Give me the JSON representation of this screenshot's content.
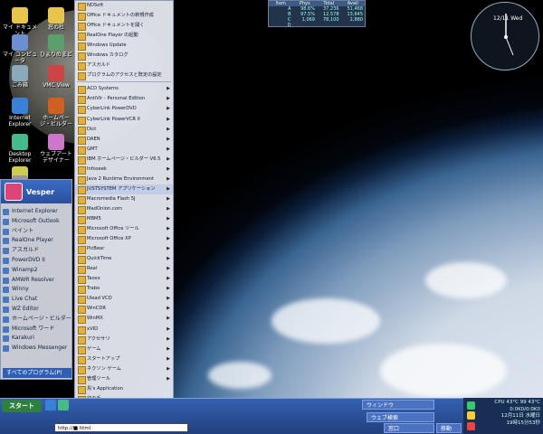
{
  "desktop_icons": [
    {
      "label": "マイ ドキュメント",
      "icon": "folder-icon",
      "color": "#e8c44a"
    },
    {
      "label": "窓の杜",
      "icon": "folder-icon",
      "color": "#e8c44a"
    },
    {
      "label": "マイ コンピュータ",
      "icon": "computer-icon",
      "color": "#6b8fd0"
    },
    {
      "label": "ひよりのまど",
      "icon": "globe-icon",
      "color": "#5aa06b"
    },
    {
      "label": "ごみ箱",
      "icon": "recycle-bin-icon",
      "color": "#8ab"
    },
    {
      "label": "VMC View",
      "icon": "vm-icon",
      "color": "#c44"
    },
    {
      "label": "Internet Explorer",
      "icon": "ie-icon",
      "color": "#3a7fd8"
    },
    {
      "label": "ホームページ・ビルダー",
      "icon": "builder-icon",
      "color": "#d06020"
    },
    {
      "label": "Desktop Explorer",
      "icon": "desktop-icon",
      "color": "#4b8"
    },
    {
      "label": "ウェブアートデザイナー",
      "icon": "design-icon",
      "color": "#c7c"
    },
    {
      "label": "",
      "icon": "text-icon",
      "color": "#cc5"
    },
    {
      "label": "",
      "icon": "tool-icon",
      "color": "#999"
    }
  ],
  "meter": {
    "headers": [
      "Item",
      "Phys",
      "Total",
      "Avail"
    ],
    "rows": [
      [
        "A",
        "98.6%",
        "37,236",
        "51,468"
      ],
      [
        "B",
        "97.5%",
        "12,578",
        "13,645"
      ],
      [
        "C",
        "1,069",
        "78,100",
        "2,880"
      ],
      [
        "D",
        "",
        "",
        ""
      ]
    ]
  },
  "clock": {
    "date": "12/11 Wed"
  },
  "start_menu": {
    "user": "Vesper",
    "pinned": [
      "Internet Explorer",
      "Microsoft Outlook",
      "ペイント",
      "RealOne Player",
      "アスガルド",
      "PowerDVD II",
      "Winamp2",
      "AMWR Resolver",
      "Winny",
      "Live Chat",
      "WZ Editor",
      "ホームページ・ビルダー",
      "Microsoft ワード",
      "Karakuri",
      "Windows Messenger"
    ],
    "all_programs": "すべてのプログラム(P)"
  },
  "program_menu": {
    "top_items": [
      "NDSoft",
      "Office ドキュメントの新規作成",
      "Office ドキュメントを開く",
      "RealOne Player の起動",
      "Windows Update",
      "Windows カタログ",
      "アスガルド",
      "プログラムのアクセスと既定の設定"
    ],
    "items": [
      {
        "label": "ACD Systems",
        "sub": true
      },
      {
        "label": "AntiVir - Personal Edition",
        "sub": true
      },
      {
        "label": "CyberLink PowerDVD",
        "sub": true
      },
      {
        "label": "CyberLink PowerVCR II",
        "sub": true
      },
      {
        "label": "Dict",
        "sub": true
      },
      {
        "label": "DAEN",
        "sub": true
      },
      {
        "label": "GMT",
        "sub": true
      },
      {
        "label": "IBM ホームページ・ビルダー V6.5",
        "sub": true
      },
      {
        "label": "Infoseek",
        "sub": true
      },
      {
        "label": "Java 2 Runtime Environment",
        "sub": true
      },
      {
        "label": "JUSTSYSTEM アプリケーション",
        "sub": true,
        "selected": true
      },
      {
        "label": "Macromedia Flash 5J",
        "sub": true
      },
      {
        "label": "MadOnion.com",
        "sub": true
      },
      {
        "label": "MBM5",
        "sub": true
      },
      {
        "label": "Microsoft Office ツール",
        "sub": true
      },
      {
        "label": "Microsoft Office XP",
        "sub": true
      },
      {
        "label": "PicBear",
        "sub": true
      },
      {
        "label": "QuickTime",
        "sub": true
      },
      {
        "label": "Real",
        "sub": true
      },
      {
        "label": "Taoxx",
        "sub": true
      },
      {
        "label": "Trabo",
        "sub": true
      },
      {
        "label": "Ulead VCD",
        "sub": true
      },
      {
        "label": "WinCDR",
        "sub": true
      },
      {
        "label": "WinMX",
        "sub": true
      },
      {
        "label": "xVID",
        "sub": true
      },
      {
        "label": "アクセサリ",
        "sub": true
      },
      {
        "label": "ゲーム",
        "sub": true
      },
      {
        "label": "スタートアップ",
        "sub": true
      },
      {
        "label": "ネクソン ゲーム",
        "sub": true
      },
      {
        "label": "管理ツール",
        "sub": true
      },
      {
        "label": "鳥's Application",
        "sub": false
      },
      {
        "label": "窓の手",
        "sub": false
      },
      {
        "label": "窓の鳥",
        "sub": false
      },
      {
        "label": "Internet Explorer",
        "sub": false
      }
    ]
  },
  "taskbar": {
    "start": "スタート",
    "address": "http://■.html",
    "buttons": [
      "ウィンドウ",
      "ウェブ検索",
      "窓口",
      "移動"
    ],
    "tray": [
      "CPU 43°C 99 43°C",
      "0:0K0/0:0K0",
      "12月11日 水曜日",
      "19時15分53秒"
    ]
  }
}
